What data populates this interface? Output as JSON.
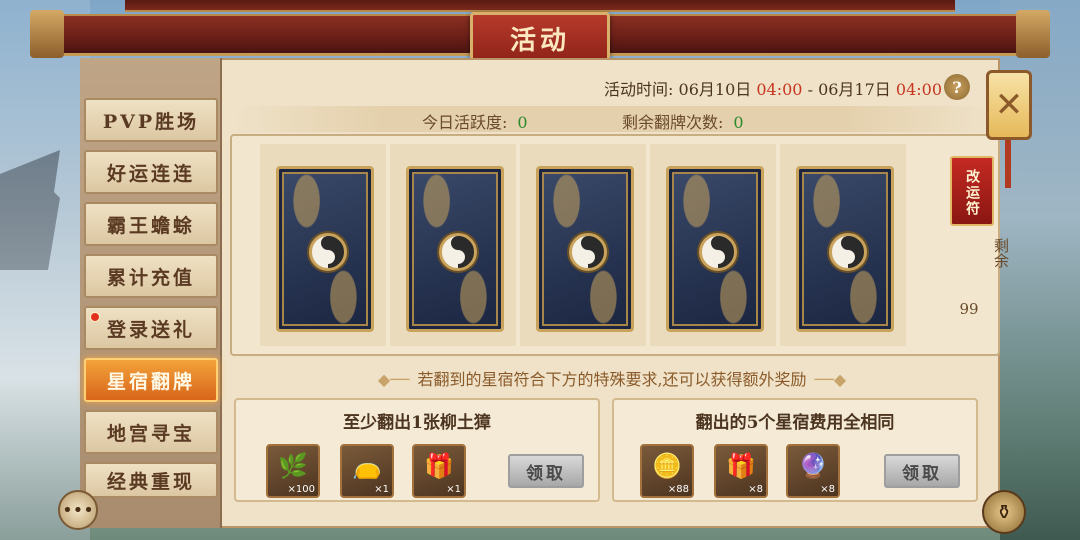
{
  "window": {
    "title": "活动"
  },
  "sidebar": {
    "items": [
      {
        "label": "PVP胜场"
      },
      {
        "label": "好运连连"
      },
      {
        "label": "霸王蟾蜍"
      },
      {
        "label": "累计充值"
      },
      {
        "label": "登录送礼",
        "badge": true
      },
      {
        "label": "星宿翻牌",
        "active": true
      },
      {
        "label": "地宫寻宝"
      },
      {
        "label": "经典重现"
      }
    ]
  },
  "event_time": {
    "label": "活动时间:",
    "start_date": "06月10日",
    "start_time": "04:00",
    "separator": "-",
    "end_date": "06月17日",
    "end_time": "04:00",
    "help": "?"
  },
  "stats": {
    "activity_label": "今日活跃度:",
    "activity_value": "0",
    "flips_label": "剩余翻牌次数:",
    "flips_value": "0"
  },
  "token": {
    "name": "改运符",
    "remaining_label": "剩余",
    "remaining_count": "99"
  },
  "hint": "若翻到的星宿符合下方的特殊要求,还可以获得额外奖励",
  "requirements": [
    {
      "title": "至少翻出1张柳土獐",
      "rewards": [
        {
          "icon": "green-herb-icon",
          "glyph": "🌿",
          "qty": "×100"
        },
        {
          "icon": "pouch-icon",
          "glyph": "👝",
          "qty": "×1"
        },
        {
          "icon": "red-gift-box-icon",
          "glyph": "🎁",
          "qty": "×1"
        }
      ],
      "claim_label": "领取"
    },
    {
      "title": "翻出的5个星宿费用全相同",
      "rewards": [
        {
          "icon": "gold-ingot-icon",
          "glyph": "🪙",
          "qty": "×88"
        },
        {
          "icon": "red-gift-box-icon",
          "glyph": "🎁",
          "qty": "×8"
        },
        {
          "icon": "blue-orb-icon",
          "glyph": "🔮",
          "qty": "×8"
        }
      ],
      "claim_label": "领取"
    }
  ],
  "close_glyph": "✕",
  "chat_glyph": "•••",
  "bag_glyph": "⚱"
}
